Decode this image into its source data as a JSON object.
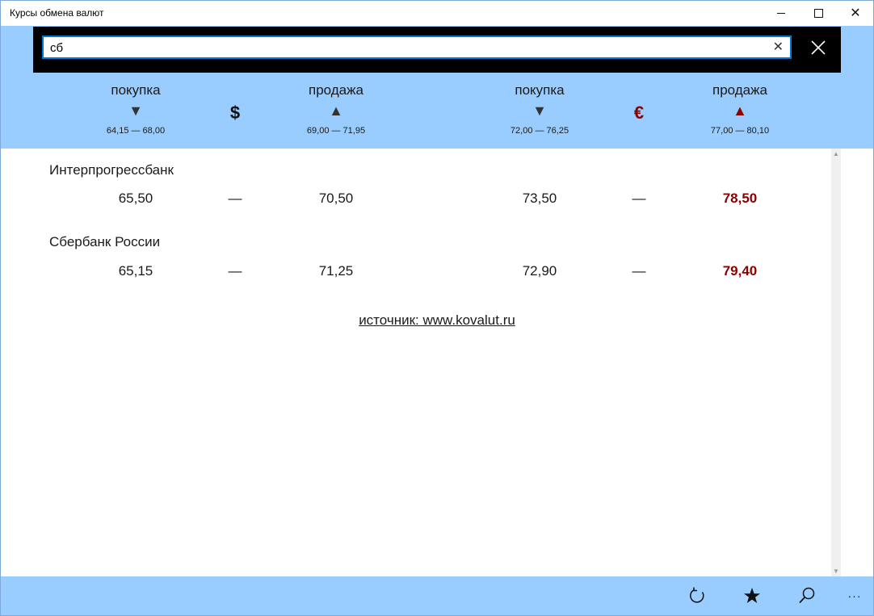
{
  "window": {
    "title": "Курсы обмена валют"
  },
  "search": {
    "value": "сб"
  },
  "header": {
    "usd": {
      "symbol": "$",
      "buy": {
        "label": "покупка",
        "arrow": "▼",
        "range": "64,15 — 68,00"
      },
      "sell": {
        "label": "продажа",
        "arrow": "▲",
        "range": "69,00 — 71,95"
      }
    },
    "eur": {
      "symbol": "€",
      "buy": {
        "label": "покупка",
        "arrow": "▼",
        "range": "72,00 — 76,25"
      },
      "sell": {
        "label": "продажа",
        "arrow": "▲",
        "range": "77,00 — 80,10"
      }
    }
  },
  "banks": [
    {
      "name": "Интерпрогрессбанк",
      "usd_buy": "65,50",
      "usd_sep": "—",
      "usd_sell": "70,50",
      "eur_buy": "73,50",
      "eur_sep": "—",
      "eur_sell": "78,50"
    },
    {
      "name": "Сбербанк России",
      "usd_buy": "65,15",
      "usd_sep": "—",
      "usd_sell": "71,25",
      "eur_buy": "72,90",
      "eur_sep": "—",
      "eur_sell": "79,40"
    }
  ],
  "source": {
    "text": "источник: www.kovalut.ru"
  },
  "appbar": {
    "refresh_icon": "refresh-icon",
    "favorite_icon": "star-icon",
    "search_icon": "search-icon",
    "more_label": "···"
  },
  "colors": {
    "accent_band": "#99ccff",
    "euro_red": "#8b0000",
    "focus_blue": "#0078d7"
  }
}
